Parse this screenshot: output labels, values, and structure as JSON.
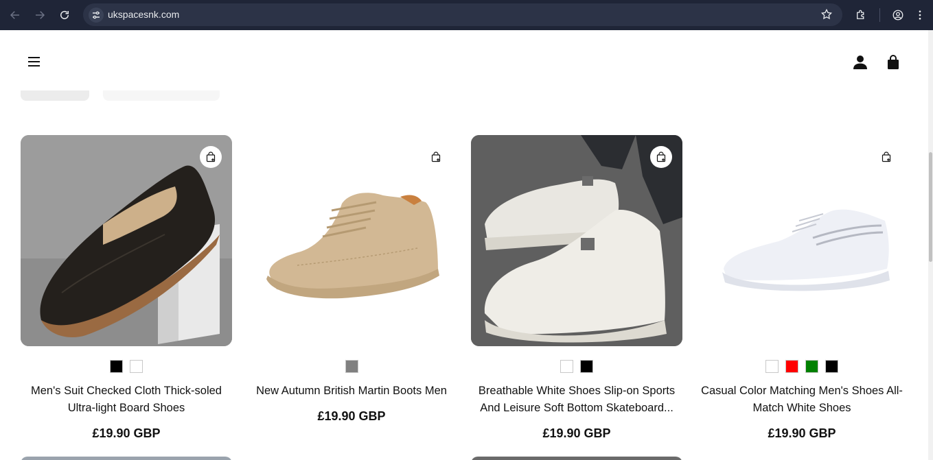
{
  "browser": {
    "url": "ukspacesnk.com"
  },
  "header": {
    "menu_icon": "hamburger-icon",
    "account_icon": "user-icon",
    "cart_icon": "shopping-bag-icon"
  },
  "products": [
    {
      "title": "Men's Suit Checked Cloth Thick-soled Ultra-light Board Shoes",
      "price": "£19.90 GBP",
      "swatches": [
        "#000000",
        "#ffffff"
      ],
      "image": "black-leather-sneaker"
    },
    {
      "title": "New Autumn British Martin Boots Men",
      "price": "£19.90 GBP",
      "swatches": [
        "#808080"
      ],
      "image": "beige-suede-boot"
    },
    {
      "title": "Breathable White Shoes Slip-on Sports And Leisure Soft Bottom Skateboard...",
      "price": "£19.90 GBP",
      "swatches": [
        "#ffffff",
        "#000000"
      ],
      "image": "white-sneakers-on-feet"
    },
    {
      "title": "Casual Color Matching Men's Shoes All-Match White Shoes",
      "price": "£19.90 GBP",
      "swatches": [
        "#ffffff",
        "#ff0000",
        "#008000",
        "#000000"
      ],
      "image": "white-low-sneaker"
    }
  ],
  "colors": {
    "chrome_bg": "#1f2537",
    "omnibox_bg": "#2c3347",
    "text": "#111111"
  }
}
